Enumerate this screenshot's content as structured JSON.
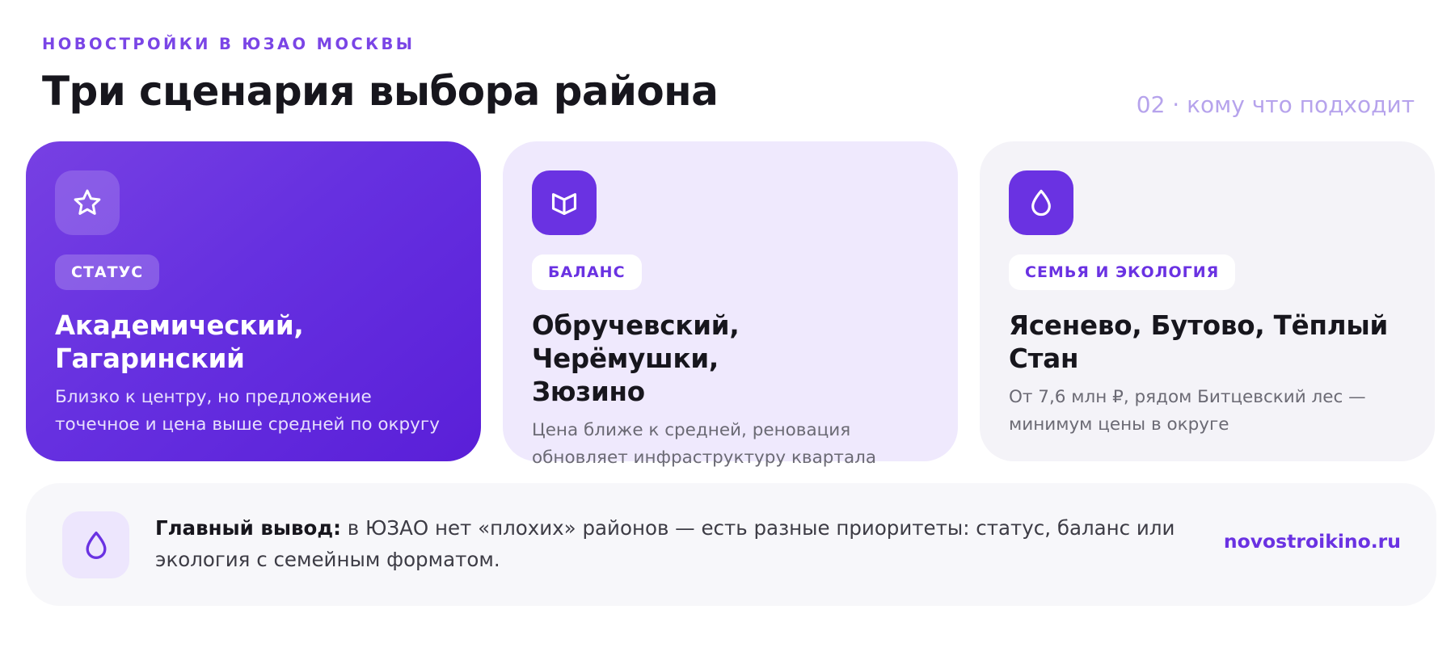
{
  "header": {
    "eyebrow": "НОВОСТРОЙКИ В ЮЗАО МОСКВЫ",
    "title": "Три сценария выбора района",
    "section_label": "02 · кому что подходит"
  },
  "cards": [
    {
      "icon": "star-icon",
      "tag": "СТАТУС",
      "title_line1": "Академический,",
      "title_line2": "Гагаринский",
      "text_line1": "Близко к центру, но предложение",
      "text_line2": "точечное и цена выше средней по округу"
    },
    {
      "icon": "open-book-icon",
      "tag": "БАЛАНС",
      "title_line1": "Обручевский, Черёмушки,",
      "title_line2": "Зюзино",
      "text_line1": "Цена ближе к средней, реновация",
      "text_line2": "обновляет инфраструктуру квартала"
    },
    {
      "icon": "drop-icon",
      "tag": "СЕМЬЯ И ЭКОЛОГИЯ",
      "title_line1": "Ясенево, Бутово, Тёплый",
      "title_line2": "Стан",
      "text_line1": "От 7,6 млн ₽, рядом Битцевский лес —",
      "text_line2": "минимум цены в округе"
    }
  ],
  "summary": {
    "icon": "drop-icon",
    "label": "Главный вывод:",
    "text_line1": " в ЮЗАО нет «плохих» районов — есть разные приоритеты: статус, баланс или",
    "text_line2": "экология с семейным форматом.",
    "link": "novostroikino.ru"
  },
  "colors": {
    "accent": "#6a32e2",
    "eyebrow": "#7a45e6",
    "muted_label": "#b6a3ec",
    "status_card_gradient": [
      "#7740e3",
      "#5a1fd8"
    ],
    "balance_card": "#efe9fd",
    "family_card": "#f4f3f8",
    "summary_bg": "#f7f7fa"
  }
}
